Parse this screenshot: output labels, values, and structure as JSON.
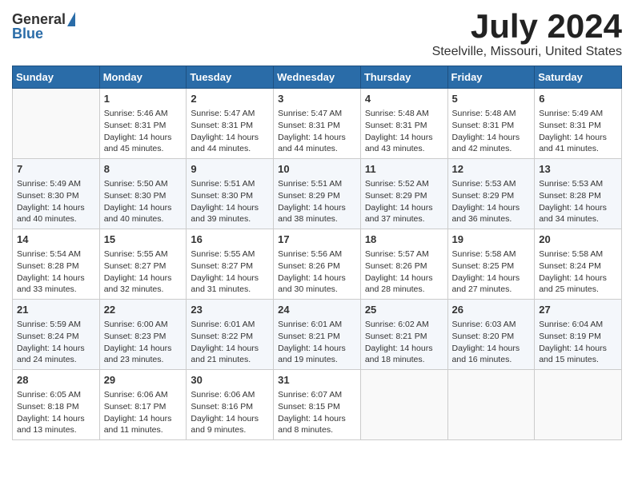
{
  "header": {
    "logo_general": "General",
    "logo_blue": "Blue",
    "month_year": "July 2024",
    "location": "Steelville, Missouri, United States"
  },
  "days_of_week": [
    "Sunday",
    "Monday",
    "Tuesday",
    "Wednesday",
    "Thursday",
    "Friday",
    "Saturday"
  ],
  "weeks": [
    [
      {
        "day": "",
        "info": ""
      },
      {
        "day": "1",
        "info": "Sunrise: 5:46 AM\nSunset: 8:31 PM\nDaylight: 14 hours\nand 45 minutes."
      },
      {
        "day": "2",
        "info": "Sunrise: 5:47 AM\nSunset: 8:31 PM\nDaylight: 14 hours\nand 44 minutes."
      },
      {
        "day": "3",
        "info": "Sunrise: 5:47 AM\nSunset: 8:31 PM\nDaylight: 14 hours\nand 44 minutes."
      },
      {
        "day": "4",
        "info": "Sunrise: 5:48 AM\nSunset: 8:31 PM\nDaylight: 14 hours\nand 43 minutes."
      },
      {
        "day": "5",
        "info": "Sunrise: 5:48 AM\nSunset: 8:31 PM\nDaylight: 14 hours\nand 42 minutes."
      },
      {
        "day": "6",
        "info": "Sunrise: 5:49 AM\nSunset: 8:31 PM\nDaylight: 14 hours\nand 41 minutes."
      }
    ],
    [
      {
        "day": "7",
        "info": "Sunrise: 5:49 AM\nSunset: 8:30 PM\nDaylight: 14 hours\nand 40 minutes."
      },
      {
        "day": "8",
        "info": "Sunrise: 5:50 AM\nSunset: 8:30 PM\nDaylight: 14 hours\nand 40 minutes."
      },
      {
        "day": "9",
        "info": "Sunrise: 5:51 AM\nSunset: 8:30 PM\nDaylight: 14 hours\nand 39 minutes."
      },
      {
        "day": "10",
        "info": "Sunrise: 5:51 AM\nSunset: 8:29 PM\nDaylight: 14 hours\nand 38 minutes."
      },
      {
        "day": "11",
        "info": "Sunrise: 5:52 AM\nSunset: 8:29 PM\nDaylight: 14 hours\nand 37 minutes."
      },
      {
        "day": "12",
        "info": "Sunrise: 5:53 AM\nSunset: 8:29 PM\nDaylight: 14 hours\nand 36 minutes."
      },
      {
        "day": "13",
        "info": "Sunrise: 5:53 AM\nSunset: 8:28 PM\nDaylight: 14 hours\nand 34 minutes."
      }
    ],
    [
      {
        "day": "14",
        "info": "Sunrise: 5:54 AM\nSunset: 8:28 PM\nDaylight: 14 hours\nand 33 minutes."
      },
      {
        "day": "15",
        "info": "Sunrise: 5:55 AM\nSunset: 8:27 PM\nDaylight: 14 hours\nand 32 minutes."
      },
      {
        "day": "16",
        "info": "Sunrise: 5:55 AM\nSunset: 8:27 PM\nDaylight: 14 hours\nand 31 minutes."
      },
      {
        "day": "17",
        "info": "Sunrise: 5:56 AM\nSunset: 8:26 PM\nDaylight: 14 hours\nand 30 minutes."
      },
      {
        "day": "18",
        "info": "Sunrise: 5:57 AM\nSunset: 8:26 PM\nDaylight: 14 hours\nand 28 minutes."
      },
      {
        "day": "19",
        "info": "Sunrise: 5:58 AM\nSunset: 8:25 PM\nDaylight: 14 hours\nand 27 minutes."
      },
      {
        "day": "20",
        "info": "Sunrise: 5:58 AM\nSunset: 8:24 PM\nDaylight: 14 hours\nand 25 minutes."
      }
    ],
    [
      {
        "day": "21",
        "info": "Sunrise: 5:59 AM\nSunset: 8:24 PM\nDaylight: 14 hours\nand 24 minutes."
      },
      {
        "day": "22",
        "info": "Sunrise: 6:00 AM\nSunset: 8:23 PM\nDaylight: 14 hours\nand 23 minutes."
      },
      {
        "day": "23",
        "info": "Sunrise: 6:01 AM\nSunset: 8:22 PM\nDaylight: 14 hours\nand 21 minutes."
      },
      {
        "day": "24",
        "info": "Sunrise: 6:01 AM\nSunset: 8:21 PM\nDaylight: 14 hours\nand 19 minutes."
      },
      {
        "day": "25",
        "info": "Sunrise: 6:02 AM\nSunset: 8:21 PM\nDaylight: 14 hours\nand 18 minutes."
      },
      {
        "day": "26",
        "info": "Sunrise: 6:03 AM\nSunset: 8:20 PM\nDaylight: 14 hours\nand 16 minutes."
      },
      {
        "day": "27",
        "info": "Sunrise: 6:04 AM\nSunset: 8:19 PM\nDaylight: 14 hours\nand 15 minutes."
      }
    ],
    [
      {
        "day": "28",
        "info": "Sunrise: 6:05 AM\nSunset: 8:18 PM\nDaylight: 14 hours\nand 13 minutes."
      },
      {
        "day": "29",
        "info": "Sunrise: 6:06 AM\nSunset: 8:17 PM\nDaylight: 14 hours\nand 11 minutes."
      },
      {
        "day": "30",
        "info": "Sunrise: 6:06 AM\nSunset: 8:16 PM\nDaylight: 14 hours\nand 9 minutes."
      },
      {
        "day": "31",
        "info": "Sunrise: 6:07 AM\nSunset: 8:15 PM\nDaylight: 14 hours\nand 8 minutes."
      },
      {
        "day": "",
        "info": ""
      },
      {
        "day": "",
        "info": ""
      },
      {
        "day": "",
        "info": ""
      }
    ]
  ]
}
